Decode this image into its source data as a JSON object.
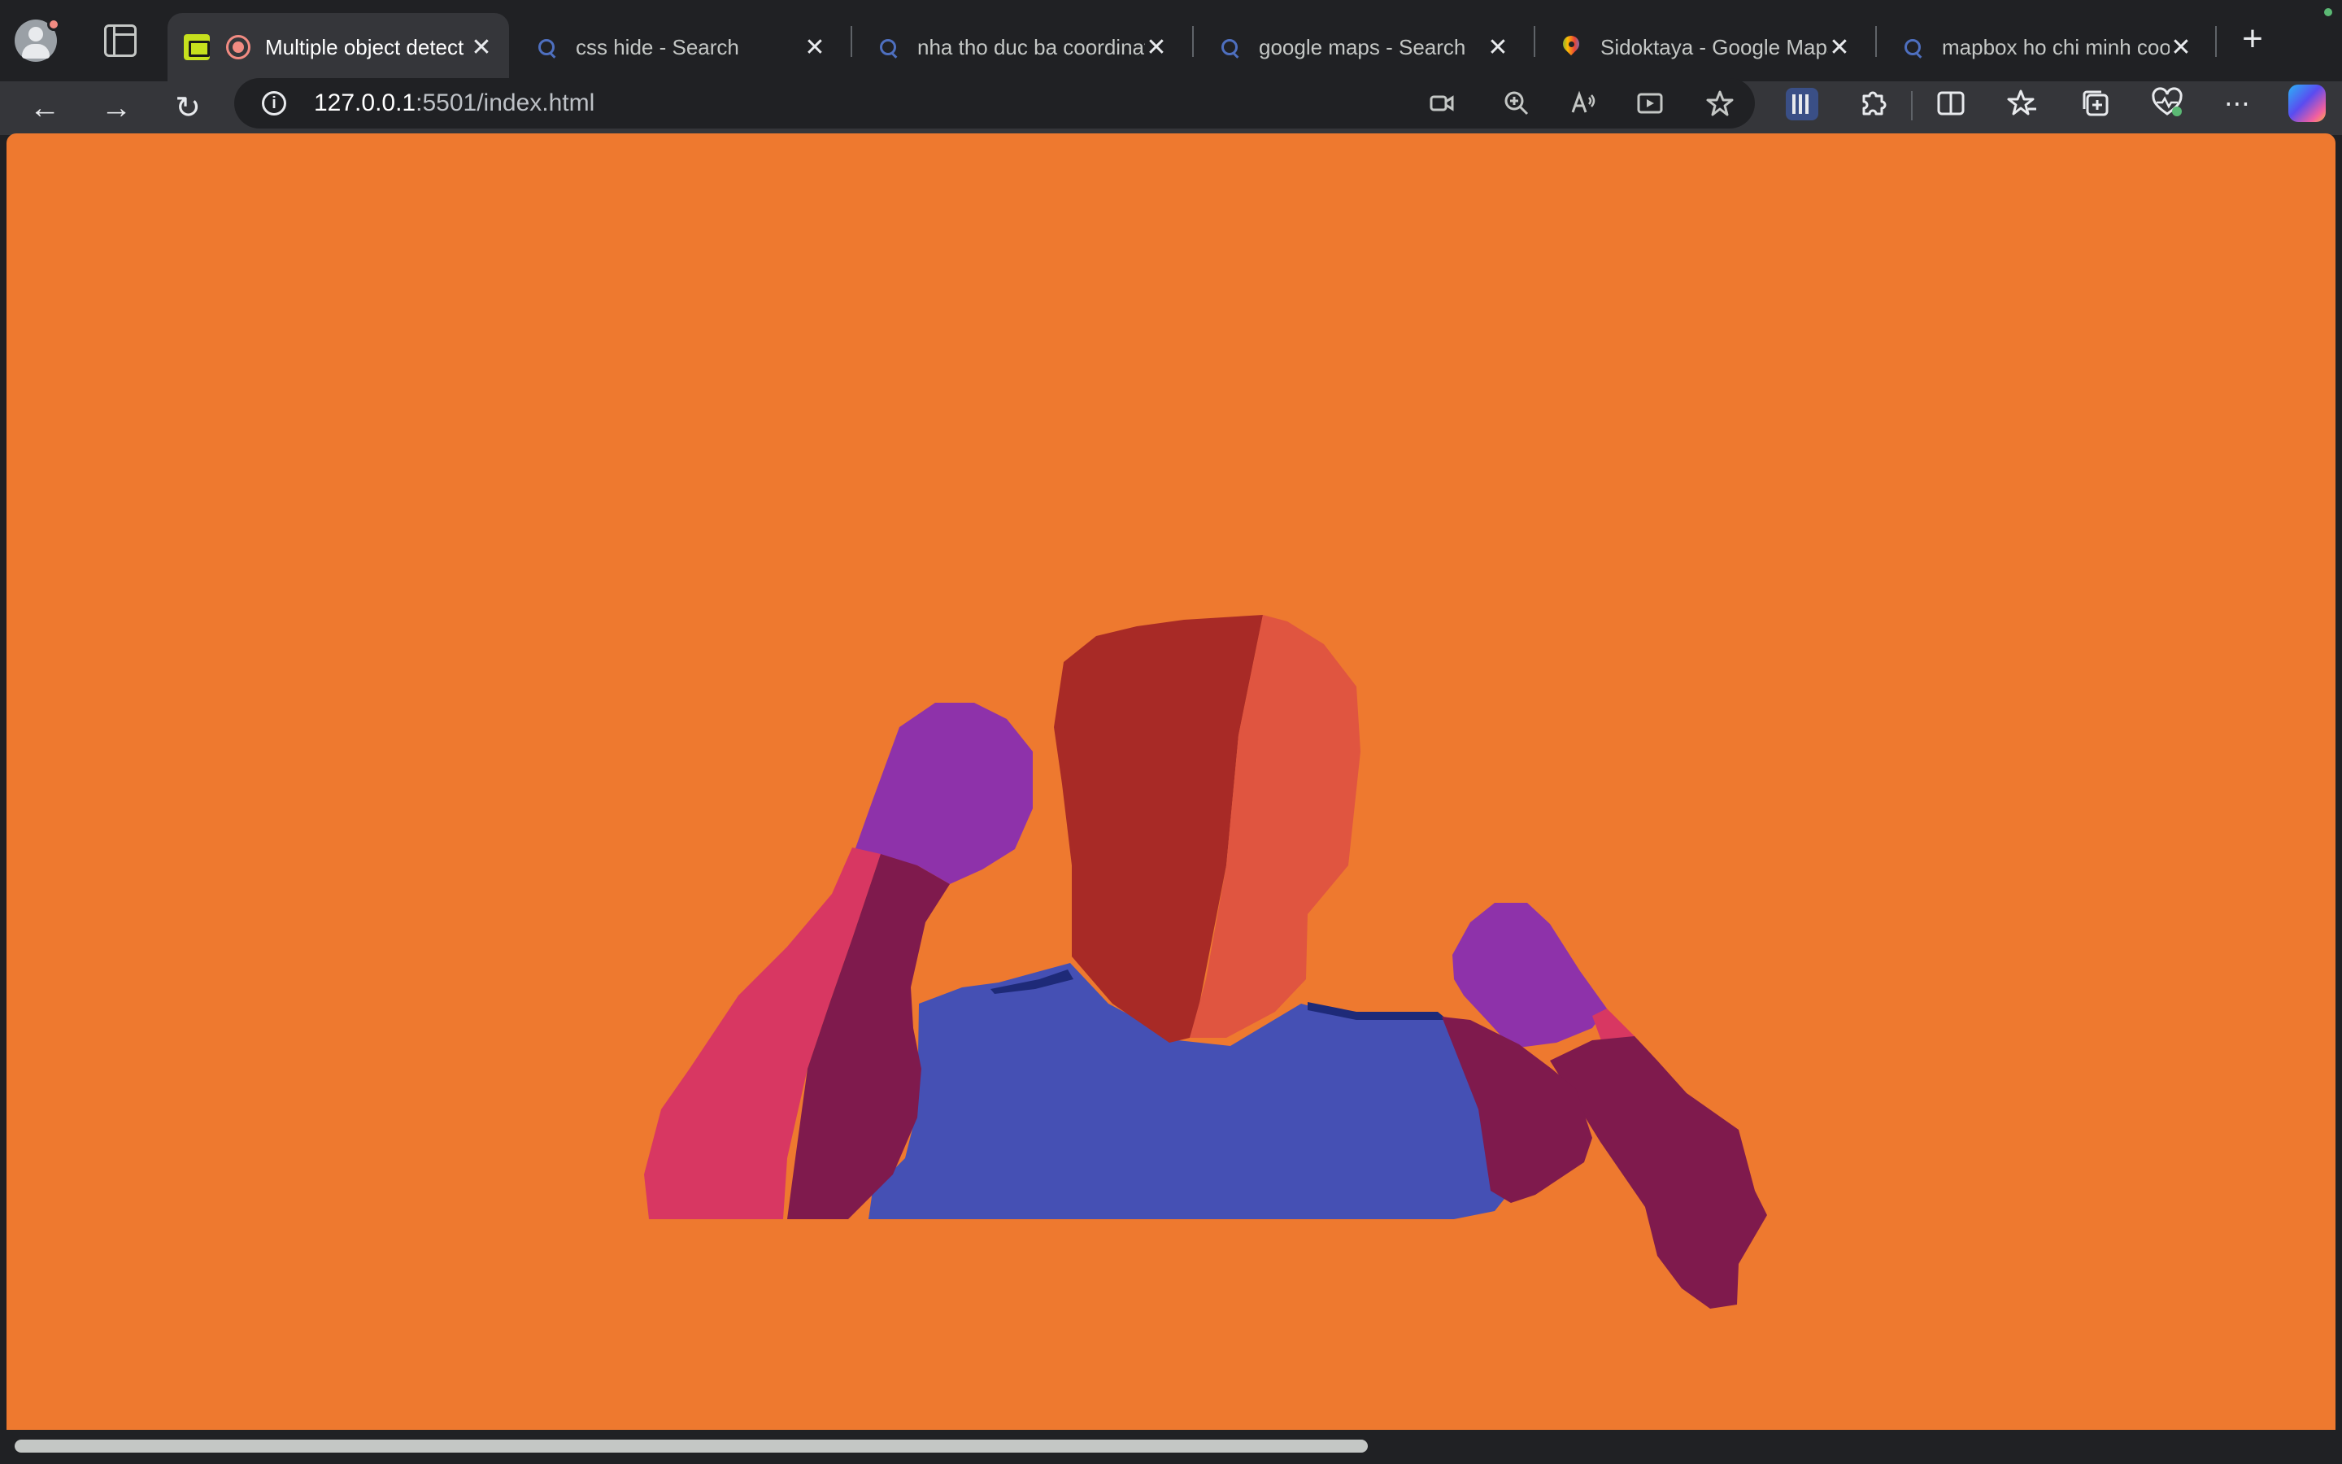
{
  "window": {
    "tabs": [
      {
        "title": "Multiple object detect",
        "favicon": "live-server-icon",
        "recording": true,
        "active": true
      },
      {
        "title": "css hide - Search",
        "favicon": "search-icon",
        "active": false
      },
      {
        "title": "nha tho duc ba coordinate",
        "favicon": "search-icon",
        "active": false
      },
      {
        "title": "google maps - Search",
        "favicon": "search-icon",
        "active": false
      },
      {
        "title": "Sidoktaya - Google Maps",
        "favicon": "google-maps-icon",
        "active": false
      },
      {
        "title": "mapbox ho chi minh coord",
        "favicon": "search-icon",
        "active": false
      }
    ],
    "tab_close_glyph": "✕",
    "new_tab_glyph": "+"
  },
  "toolbar": {
    "back": "←",
    "forward": "→",
    "reload": "↻",
    "url_host": "127.0.0.1",
    "url_path": ":5501/index.html",
    "more": "⋯"
  },
  "page": {
    "background_color": "#ee792f",
    "segmentation_colors": {
      "background": "#ee792f",
      "face_left": "#a82a26",
      "face_right": "#e05540",
      "torso": "#4550b4",
      "left_forearm": "#d83762",
      "left_upper_arm": "#7f1a4d",
      "left_hand": "#8e32aa",
      "right_upper_arm": "#7f1a4d",
      "right_forearm": "#7f1a4d",
      "right_hand": "#8e32aa",
      "right_wrist": "#d83762",
      "neck_edge": "#1e2a78"
    }
  }
}
